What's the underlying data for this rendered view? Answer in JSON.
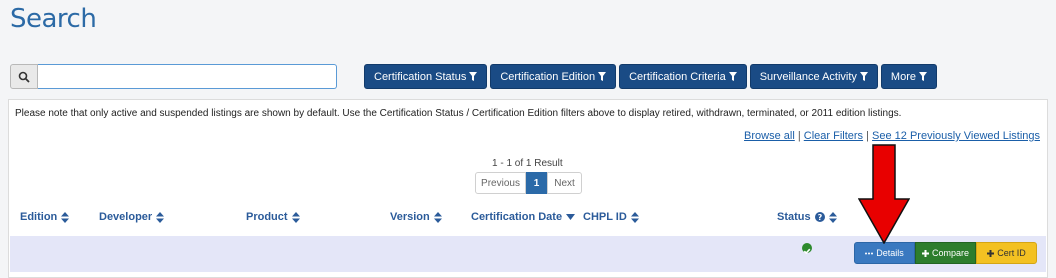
{
  "page": {
    "title": "Search"
  },
  "search": {
    "placeholder": "",
    "value": ""
  },
  "filters": [
    {
      "label": "Certification Status"
    },
    {
      "label": "Certification Edition"
    },
    {
      "label": "Certification Criteria"
    },
    {
      "label": "Surveillance Activity"
    },
    {
      "label": "More"
    }
  ],
  "notice": "Please note that only active and suspended listings are shown by default. Use the Certification Status / Certification Edition filters above to display retired, withdrawn, terminated, or 2011 edition listings.",
  "links": {
    "browse_all": "Browse all",
    "separator": " | ",
    "clear_filters": "Clear Filters",
    "previously_viewed": "See 12 Previously Viewed Listings"
  },
  "results": {
    "count_text": "1 - 1 of 1 Result"
  },
  "pagination": {
    "previous": "Previous",
    "current": "1",
    "next": "Next"
  },
  "columns": {
    "edition": "Edition",
    "developer": "Developer",
    "product": "Product",
    "version": "Version",
    "certification_date": "Certification Date",
    "chpl_id": "CHPL ID",
    "status": "Status"
  },
  "row_actions": {
    "details": "Details",
    "compare": "Compare",
    "cert_id": "Cert ID"
  },
  "colors": {
    "title": "#2c6aa6",
    "filter_button": "#1a4b85",
    "row_background": "#e4e6f8",
    "details": "#3a79c0",
    "compare": "#2d7d2d",
    "cert_id": "#f3c122",
    "arrow": "#e00000"
  }
}
